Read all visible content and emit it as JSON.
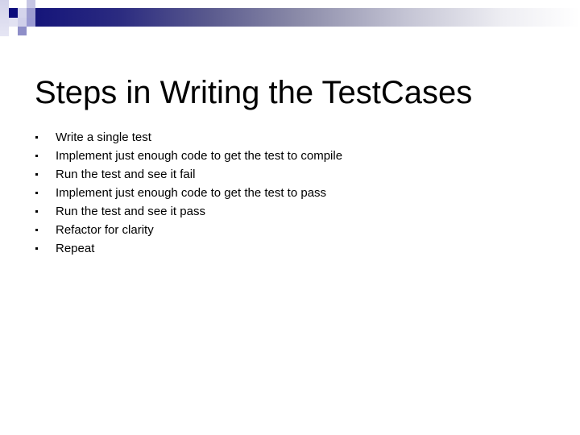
{
  "slide": {
    "title": "Steps in Writing the TestCases",
    "bullets": [
      "Write a single test",
      "Implement just enough code to get the test to compile",
      "Run the test and see it fail",
      "Implement just enough code to get the test to pass",
      "Run the test and see it pass",
      "Refactor for clarity",
      "Repeat"
    ]
  },
  "theme": {
    "accent_dark": "#15157a",
    "accent_light": "#c6c6e4",
    "text_color": "#000000",
    "background": "#ffffff"
  }
}
